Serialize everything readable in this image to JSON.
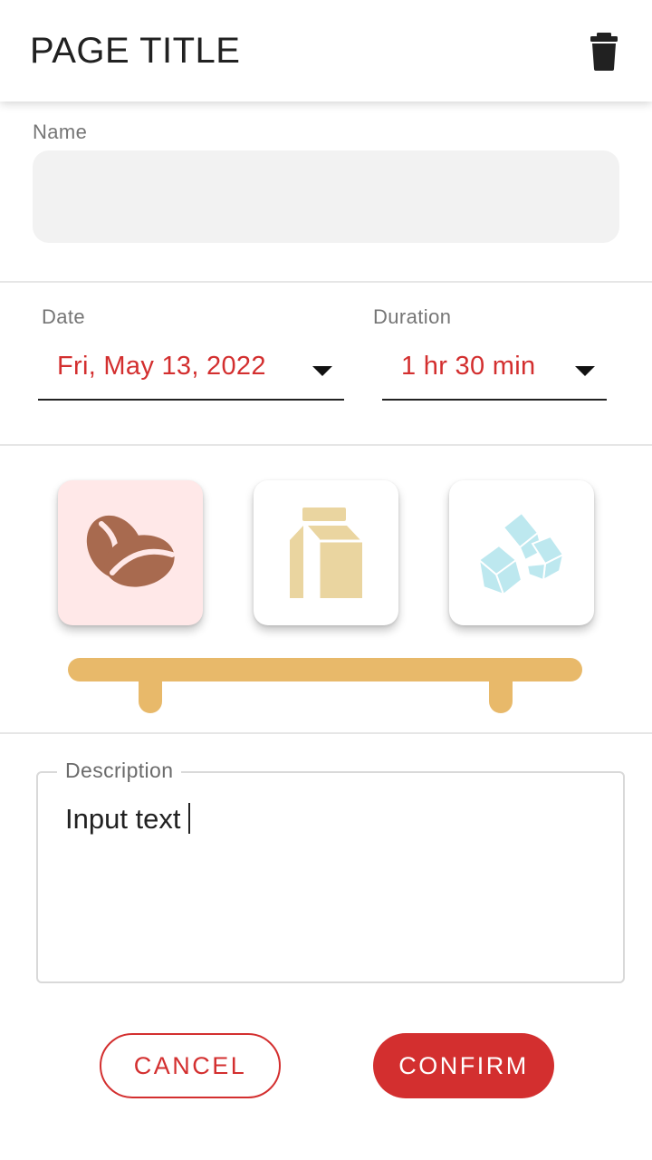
{
  "appbar": {
    "title": "PAGE TITLE",
    "delete_icon": "trash-icon"
  },
  "name_field": {
    "label": "Name",
    "value": "",
    "placeholder": ""
  },
  "date_field": {
    "label": "Date",
    "value": "Fri, May 13, 2022"
  },
  "duration_field": {
    "label": "Duration",
    "value": "1 hr 30 min"
  },
  "ingredients": [
    {
      "icon": "coffee-beans-icon",
      "selected": true,
      "color": "#a86a4f"
    },
    {
      "icon": "milk-carton-icon",
      "selected": false,
      "color": "#ead5a0"
    },
    {
      "icon": "sugar-cubes-icon",
      "selected": false,
      "color": "#bde8ef"
    }
  ],
  "description": {
    "label": "Description",
    "value": "Input text"
  },
  "actions": {
    "cancel_label": "CANCEL",
    "confirm_label": "CONFIRM"
  },
  "colors": {
    "accent": "#d32f2f",
    "selected_tile_bg": "#ffe8e8",
    "bracket": "#e8b96a",
    "input_bg": "#f2f2f2"
  }
}
